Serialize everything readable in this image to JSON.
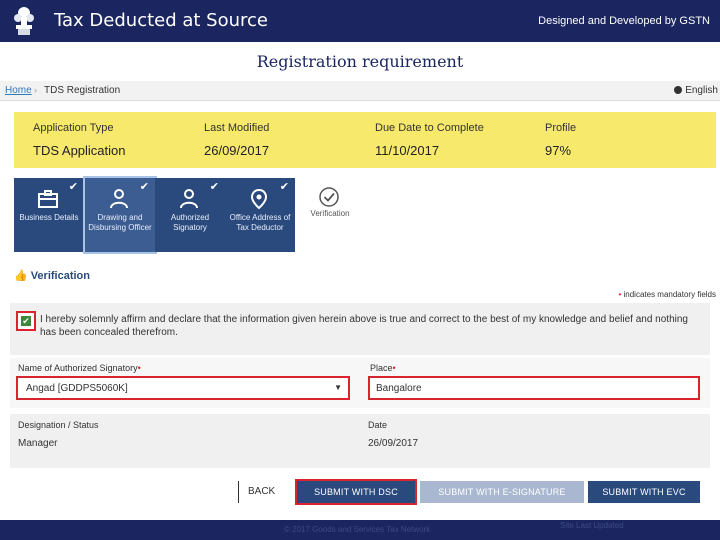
{
  "banner": {
    "title": "Tax Deducted at Source",
    "credit": "Designed and Developed by GSTN"
  },
  "slide_title": "Registration requirement",
  "breadcrumb": {
    "home": "Home",
    "separator": "›",
    "current": "TDS Registration",
    "language": "English"
  },
  "summary": {
    "columns": [
      {
        "label": "Application Type",
        "value": "TDS Application"
      },
      {
        "label": "Last Modified",
        "value": "26/09/2017"
      },
      {
        "label": "Due Date to Complete",
        "value": "11/10/2017"
      },
      {
        "label": "Profile",
        "value": "97%"
      }
    ]
  },
  "tabs": [
    {
      "label": "Business Details",
      "icon": "briefcase-icon",
      "completed": true
    },
    {
      "label": "Drawing and Disbursing Officer",
      "icon": "person-icon",
      "completed": true,
      "active": true
    },
    {
      "label": "Authorized Signatory",
      "icon": "person-icon",
      "completed": true
    },
    {
      "label": "Office Address of Tax Deductor",
      "icon": "location-pin-icon",
      "completed": true
    },
    {
      "label": "Verification",
      "icon": "check-circle-icon",
      "completed": false
    }
  ],
  "verification": {
    "heading": "Verification",
    "mandatory_note": "indicates mandatory fields",
    "declaration": "I hereby solemnly affirm and declare that the information given herein above is true and correct to the best of my knowledge and belief and nothing has been concealed therefrom.",
    "declaration_checked": true,
    "signatory_label": "Name of Authorized Signatory",
    "signatory_value": "Angad [GDDPS5060K]",
    "place_label": "Place",
    "place_value": "Bangalore",
    "designation_label": "Designation / Status",
    "designation_value": "Manager",
    "date_label": "Date",
    "date_value": "26/09/2017"
  },
  "buttons": {
    "back": "BACK",
    "submit_dsc": "SUBMIT WITH DSC",
    "submit_esign": "SUBMIT WITH E-SIGNATURE",
    "submit_evc": "SUBMIT WITH EVC"
  },
  "footer": {
    "text": "© 2017 Goods and Services Tax Network",
    "page": "Site Last Updated"
  },
  "colors": {
    "banner": "#1b2660",
    "summary_bg": "#f7e96b",
    "tab_bg": "#2a4a7d",
    "highlight": "#d9232d"
  }
}
